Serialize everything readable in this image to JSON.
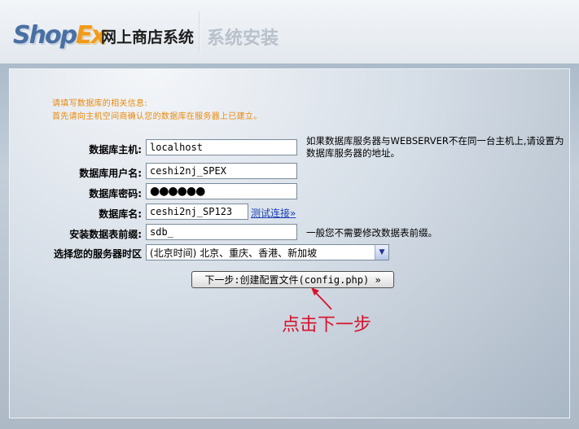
{
  "header": {
    "logo_text_1": "Shop",
    "logo_text_2": "Ex",
    "brand": "网上商店系统",
    "page_title": "系统安装"
  },
  "hints": {
    "line1": "请填写数据库的相关信息:",
    "line2": "首先请向主机空间商确认您的数据库在服务器上已建立。"
  },
  "form": {
    "db_host": {
      "label": "数据库主机:",
      "value": "localhost",
      "note": "如果数据库服务器与WEBSERVER不在同一台主机上,请设置为数据库服务器的地址。"
    },
    "db_user": {
      "label": "数据库用户名:",
      "value": "ceshi2nj_SPEX"
    },
    "db_password": {
      "label": "数据库密码:",
      "masked": "●●●●●●"
    },
    "db_name": {
      "label": "数据库名:",
      "value": "ceshi2nj_SP123",
      "test_link": "测试连接»"
    },
    "table_prefix": {
      "label": "安装数据表前缀:",
      "value": "sdb_",
      "note": "一般您不需要修改数据表前缀。"
    },
    "timezone": {
      "label": "选择您的服务器时区",
      "selected": "(北京时间) 北京、重庆、香港、新加坡"
    }
  },
  "next_button": "下一步:创建配置文件(config.php) »",
  "annotation": {
    "text": "点击下一步",
    "color": "#d9122b"
  },
  "colors": {
    "hint": "#e98a0c",
    "link": "#1a3fb5",
    "logo_blue": "#4a6fa3",
    "logo_orange": "#f29b1a"
  }
}
